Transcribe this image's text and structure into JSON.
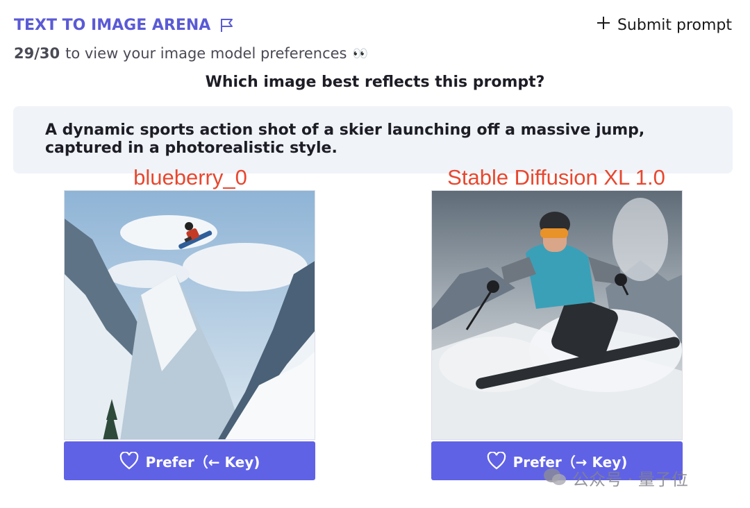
{
  "header": {
    "title": "TEXT TO IMAGE ARENA",
    "submit_label": "Submit prompt"
  },
  "progress": {
    "count": "29/30",
    "text": "to view your image model preferences",
    "emoji": "👀"
  },
  "question": "Which image best reflects this prompt?",
  "prompt": "A dynamic sports action shot of a skier launching off a massive jump, captured in a photorealistic style.",
  "models": [
    {
      "label": "blueberry_0",
      "button": "Prefer（← Key)"
    },
    {
      "label": "Stable Diffusion XL 1.0",
      "button": "Prefer（→ Key)"
    }
  ],
  "watermark": "公众号 · 量子位",
  "colors": {
    "accent": "#6062e6",
    "title": "#5a5ad6",
    "label_red": "#e8472f"
  }
}
